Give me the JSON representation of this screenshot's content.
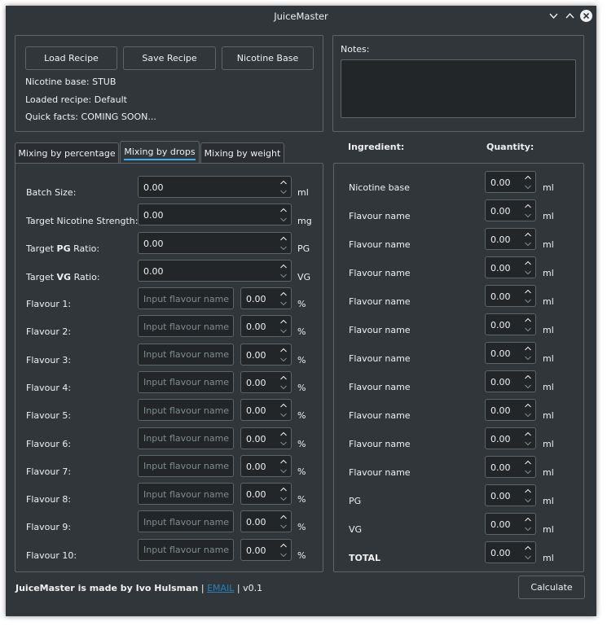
{
  "window": {
    "title": "JuiceMaster"
  },
  "top_panel": {
    "load_label": "Load Recipe",
    "save_label": "Save Recipe",
    "nicotine_base_label": "Nicotine Base",
    "nicotine_base_info": "Nicotine base: STUB",
    "loaded_recipe_info": "Loaded recipe: Default",
    "quick_facts": "Quick facts: COMING SOON..."
  },
  "notes": {
    "label": "Notes:",
    "value": ""
  },
  "tabs": [
    {
      "label": "Mixing by percentage"
    },
    {
      "label": "Mixing by drops",
      "active": true
    },
    {
      "label": "Mixing by weight"
    }
  ],
  "form": {
    "batch": {
      "label": "Batch Size:",
      "value": "0.00",
      "unit": "ml"
    },
    "nicotine": {
      "label": "Target Nicotine Strength:",
      "value": "0.00",
      "unit": "mg"
    },
    "pg": {
      "label_prefix": "Target ",
      "label_bold": "PG",
      "label_suffix": " Ratio:",
      "value": "0.00",
      "unit": "PG"
    },
    "vg": {
      "label_prefix": "Target ",
      "label_bold": "VG",
      "label_suffix": " Ratio:",
      "value": "0.00",
      "unit": "VG"
    },
    "flavour_placeholder": "Input flavour name",
    "flavours": [
      {
        "label": "Flavour 1:",
        "value": "0.00",
        "unit": "%"
      },
      {
        "label": "Flavour 2:",
        "value": "0.00",
        "unit": "%"
      },
      {
        "label": "Flavour 3:",
        "value": "0.00",
        "unit": "%"
      },
      {
        "label": "Flavour 4:",
        "value": "0.00",
        "unit": "%"
      },
      {
        "label": "Flavour 5:",
        "value": "0.00",
        "unit": "%"
      },
      {
        "label": "Flavour 6:",
        "value": "0.00",
        "unit": "%"
      },
      {
        "label": "Flavour 7:",
        "value": "0.00",
        "unit": "%"
      },
      {
        "label": "Flavour 8:",
        "value": "0.00",
        "unit": "%"
      },
      {
        "label": "Flavour 9:",
        "value": "0.00",
        "unit": "%"
      },
      {
        "label": "Flavour 10:",
        "value": "0.00",
        "unit": "%"
      }
    ]
  },
  "results": {
    "ingredient_header": "Ingredient:",
    "quantity_header": "Quantity:",
    "rows": [
      {
        "name": "Nicotine base",
        "value": "0.00",
        "unit": "ml"
      },
      {
        "name": "Flavour name",
        "value": "0.00",
        "unit": "ml"
      },
      {
        "name": "Flavour name",
        "value": "0.00",
        "unit": "ml"
      },
      {
        "name": "Flavour name",
        "value": "0.00",
        "unit": "ml"
      },
      {
        "name": "Flavour name",
        "value": "0.00",
        "unit": "ml"
      },
      {
        "name": "Flavour name",
        "value": "0.00",
        "unit": "ml"
      },
      {
        "name": "Flavour name",
        "value": "0.00",
        "unit": "ml"
      },
      {
        "name": "Flavour name",
        "value": "0.00",
        "unit": "ml"
      },
      {
        "name": "Flavour name",
        "value": "0.00",
        "unit": "ml"
      },
      {
        "name": "Flavour name",
        "value": "0.00",
        "unit": "ml"
      },
      {
        "name": "Flavour name",
        "value": "0.00",
        "unit": "ml"
      },
      {
        "name": "PG",
        "value": "0.00",
        "unit": "ml"
      },
      {
        "name": "VG",
        "value": "0.00",
        "unit": "ml"
      },
      {
        "name": "TOTAL",
        "value": "0.00",
        "unit": "ml",
        "bold": true
      }
    ]
  },
  "footer": {
    "made_by": "JuiceMaster is made by Ivo Hulsman",
    "sep1": " | ",
    "email_label": "EMAIL",
    "sep2": " | ",
    "version": "v0.1",
    "calculate_label": "Calculate"
  },
  "colors": {
    "window_bg": "#31363b",
    "input_bg": "#232629",
    "border": "#5f6467",
    "accent": "#3daee9",
    "link": "#2980b9",
    "text": "#eff0f1",
    "placeholder": "#7f8c8d"
  },
  "icons": {
    "minimize": "chevron-down-icon",
    "maximize": "chevron-up-icon",
    "close": "close-icon",
    "spin_up": "spin-up-icon",
    "spin_down": "spin-down-icon"
  }
}
